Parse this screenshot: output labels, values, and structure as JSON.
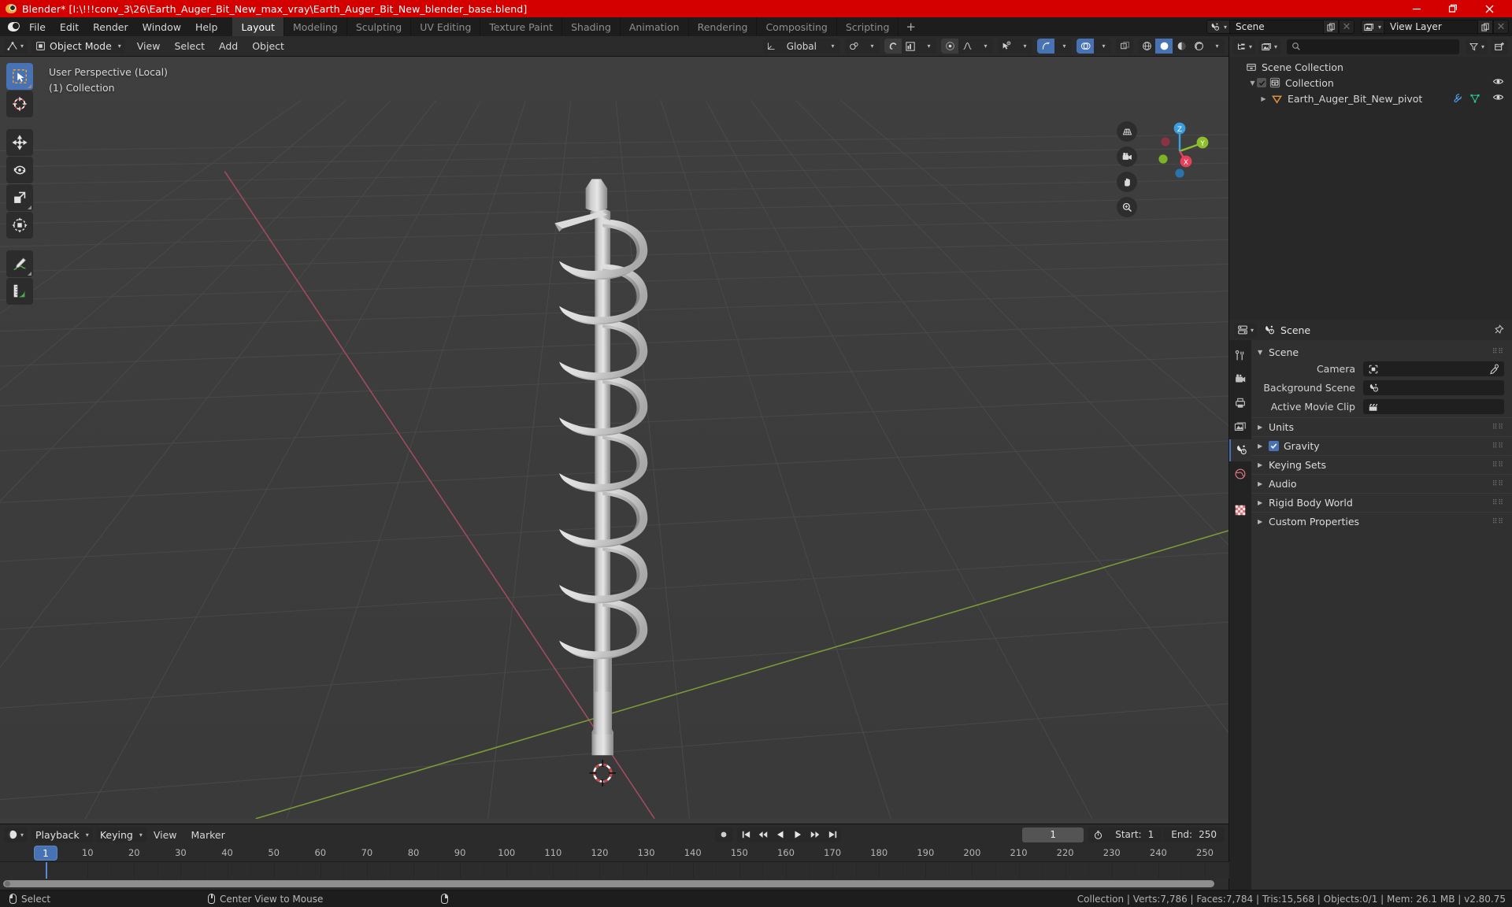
{
  "window": {
    "title": "Blender* [I:\\!!!conv_3\\26\\Earth_Auger_Bit_New_max_vray\\Earth_Auger_Bit_New_blender_base.blend]",
    "minimize": "minimize-icon",
    "maximize": "maximize-icon",
    "close": "close-icon"
  },
  "topbar": {
    "menus": [
      "File",
      "Edit",
      "Render",
      "Window",
      "Help"
    ],
    "workspaces": [
      {
        "label": "Layout",
        "active": true
      },
      {
        "label": "Modeling",
        "active": false
      },
      {
        "label": "Sculpting",
        "active": false
      },
      {
        "label": "UV Editing",
        "active": false
      },
      {
        "label": "Texture Paint",
        "active": false
      },
      {
        "label": "Shading",
        "active": false
      },
      {
        "label": "Animation",
        "active": false
      },
      {
        "label": "Rendering",
        "active": false
      },
      {
        "label": "Compositing",
        "active": false
      },
      {
        "label": "Scripting",
        "active": false
      }
    ],
    "add_workspace": "+",
    "scene_name": "Scene",
    "viewlayer_name": "View Layer"
  },
  "viewport_header": {
    "mode": "Object Mode",
    "menus": [
      "View",
      "Select",
      "Add",
      "Object"
    ],
    "transform_orientation": "Global",
    "snap_icon": "magnet-icon",
    "proportional_icon": "proportional-editing-icon"
  },
  "viewport": {
    "overlay_line1": "User Perspective (Local)",
    "overlay_line2": "(1) Collection",
    "gizmo_axes": [
      {
        "label": "Z",
        "color": "#3b9ee0"
      },
      {
        "label": "Y",
        "color": "#8cbf2a"
      },
      {
        "label": "X",
        "color": "#e8405a"
      }
    ],
    "nav_buttons": [
      "grid-toggle-icon",
      "camera-view-icon",
      "pan-view-icon",
      "zoom-view-icon"
    ],
    "tools": [
      {
        "name": "select-box-tool",
        "active": true
      },
      {
        "name": "cursor-tool",
        "active": false
      },
      {
        "name": "move-tool",
        "active": false
      },
      {
        "name": "rotate-tool",
        "active": false
      },
      {
        "name": "scale-tool",
        "active": false
      },
      {
        "name": "transform-tool",
        "active": false
      },
      {
        "name": "annotate-tool",
        "active": false
      },
      {
        "name": "measure-tool",
        "active": false
      }
    ]
  },
  "outliner": {
    "search_placeholder": "",
    "rows": [
      {
        "label": "Scene Collection",
        "indent": 0,
        "icon": "collection-icon",
        "has_disclosure": false,
        "has_checkbox": false,
        "has_eye": false
      },
      {
        "label": "Collection",
        "indent": 1,
        "icon": "collection-icon",
        "has_disclosure": true,
        "has_checkbox": true,
        "has_eye": true
      },
      {
        "label": "Earth_Auger_Bit_New_pivot",
        "indent": 2,
        "icon": "empty-icon",
        "has_disclosure": true,
        "has_checkbox": false,
        "has_eye": true
      }
    ]
  },
  "properties": {
    "breadcrumb": "Scene",
    "pin_icon": "pin-icon",
    "panel_title": "Scene",
    "fields": [
      {
        "label": "Camera",
        "icon": "camera-data-icon",
        "value": "",
        "eyedropper": true
      },
      {
        "label": "Background Scene",
        "icon": "scene-icon",
        "value": "",
        "eyedropper": false
      },
      {
        "label": "Active Movie Clip",
        "icon": "clip-icon",
        "value": "",
        "eyedropper": false
      }
    ],
    "sections": [
      {
        "label": "Units",
        "checkbox": false
      },
      {
        "label": "Gravity",
        "checkbox": true
      },
      {
        "label": "Keying Sets",
        "checkbox": false
      },
      {
        "label": "Audio",
        "checkbox": false
      },
      {
        "label": "Rigid Body World",
        "checkbox": false
      },
      {
        "label": "Custom Properties",
        "checkbox": false
      }
    ],
    "tabs": [
      {
        "name": "tool-tab",
        "active": false
      },
      {
        "name": "render-tab",
        "active": false
      },
      {
        "name": "output-tab",
        "active": false
      },
      {
        "name": "viewlayer-tab",
        "active": false
      },
      {
        "name": "scene-tab",
        "active": true
      },
      {
        "name": "world-tab",
        "active": false
      },
      {
        "name": "texture-tab",
        "active": false
      }
    ]
  },
  "timeline": {
    "editor_icon": "timeline-icon",
    "menus": [
      "Playback",
      "Keying",
      "View",
      "Marker"
    ],
    "playback_controls": [
      "record-icon",
      "jump-start-icon",
      "prev-keyframe-icon",
      "play-reverse-icon",
      "play-icon",
      "next-keyframe-icon",
      "jump-end-icon"
    ],
    "current_frame": "1",
    "start_label": "Start:",
    "start_value": "1",
    "end_label": "End:",
    "end_value": "250",
    "ticks": [
      1,
      10,
      20,
      30,
      40,
      50,
      60,
      70,
      80,
      90,
      100,
      110,
      120,
      130,
      140,
      150,
      160,
      170,
      180,
      190,
      200,
      210,
      220,
      230,
      240,
      250
    ],
    "playhead_frame": 1
  },
  "statusbar": {
    "items": [
      {
        "mouse": "left",
        "label": "Select"
      },
      {
        "mouse": "middle",
        "label": "Center View to Mouse"
      },
      {
        "mouse": "right",
        "label": ""
      }
    ],
    "stats": "Collection | Verts:7,786 | Faces:7,784 | Tris:15,568 | Objects:0/1 | Mem: 26.1 MB | v2.80.75"
  },
  "colors": {
    "title_bar": "#d40000",
    "accent": "#4772b3",
    "viewport_bg": "#3d3d3d",
    "axis_x": "#a64f5f",
    "axis_y": "#7fa33a",
    "model": "#c8c8c8"
  }
}
